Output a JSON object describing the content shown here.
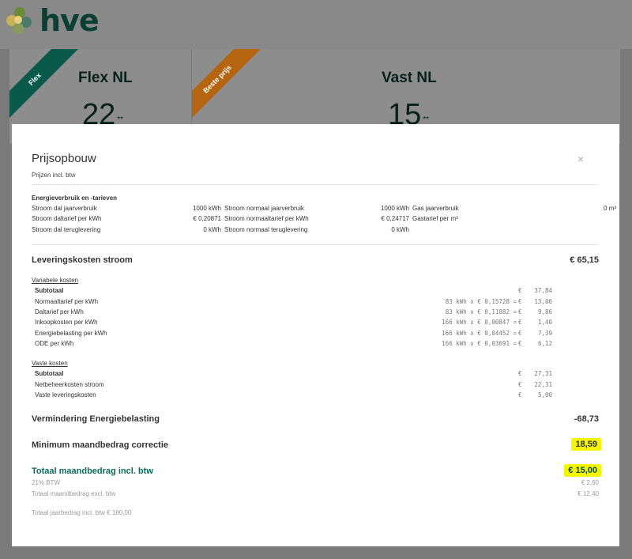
{
  "logo": {
    "text": "hve"
  },
  "cards": [
    {
      "ribbon": "Flex",
      "title": "Flex NL",
      "price": "22",
      "price_suffix": "**"
    },
    {
      "ribbon": "Beste prijs",
      "title": "Vast NL",
      "price": "15",
      "price_suffix": "**"
    }
  ],
  "modal": {
    "title": "Prijsopbouw",
    "close": "×",
    "subtitle": "Prijzen incl. btw",
    "energy": {
      "title": "Energieverbruik en -tarieven",
      "rows": [
        [
          "Stroom dal jaarverbruik",
          "1000 kWh",
          "Stroom normaal jaarverbruik",
          "1000 kWh",
          "Gas jaarverbruik",
          "0 m³"
        ],
        [
          "Stroom daltarief per kWh",
          "€ 0,20871",
          "Stroom normaaltarief per kWh",
          "€ 0,24717",
          "Gastarief per m³",
          ""
        ],
        [
          "Stroom dal teruglevering",
          "0 kWh",
          "Stroom normaal teruglevering",
          "0 kWh",
          "",
          ""
        ]
      ]
    },
    "levering": {
      "label": "Leveringskosten stroom",
      "amount": "€ 65,15"
    },
    "variabele": {
      "label": "Variabele kosten",
      "rows": [
        {
          "label": "Subtotaal",
          "calc": "",
          "eur": "€",
          "value": "37,84",
          "bold": true
        },
        {
          "label": "Normaaltarief per kWh",
          "calc": "83 kWh x € 0,15728 =",
          "eur": "€",
          "value": "13,06"
        },
        {
          "label": "Daltarief per kWh",
          "calc": "83 kWh x € 0,11882 =",
          "eur": "€",
          "value": "9,86"
        },
        {
          "label": "Inkoopkosten per kWh",
          "calc": "166 kWh x € 0,00847 =",
          "eur": "€",
          "value": "1,40"
        },
        {
          "label": "Energiebelasting per kWh",
          "calc": "166 kWh x € 0,04452 =",
          "eur": "€",
          "value": "7,39"
        },
        {
          "label": "ODE per kWh",
          "calc": "166 kWh x € 0,03691 =",
          "eur": "€",
          "value": "6,12"
        }
      ]
    },
    "vaste": {
      "label": "Vaste kosten",
      "rows": [
        {
          "label": "Subtotaal",
          "calc": "",
          "eur": "€",
          "value": "27,31",
          "bold": true
        },
        {
          "label": "Netbeheerkosten stroom",
          "calc": "",
          "eur": "€",
          "value": "22,31"
        },
        {
          "label": "Vaste leveringskosten",
          "calc": "",
          "eur": "€",
          "value": "5,00"
        }
      ]
    },
    "vermindering": {
      "label": "Vermindering Energiebelasting",
      "amount": "-68,73"
    },
    "minimum": {
      "label": "Minimum maandbedrag correctie",
      "amount": "18,59"
    },
    "totaal": {
      "label": "Totaal maandbedrag incl. btw",
      "amount": "€ 15,00"
    },
    "btw": {
      "label": "21% BTW",
      "amount": "€ 2,60"
    },
    "excl": {
      "label": "Totaal maandbedrag excl. btw",
      "amount": "€ 12,40"
    },
    "jaar": {
      "label": "Totaal jaarbedrag incl. btw € 180,00"
    }
  },
  "colors": {
    "teal": "#0a6b5b",
    "highlight": "#f5f500",
    "ribbon_flex": "#0a5a4c",
    "ribbon_best": "#b56410"
  }
}
